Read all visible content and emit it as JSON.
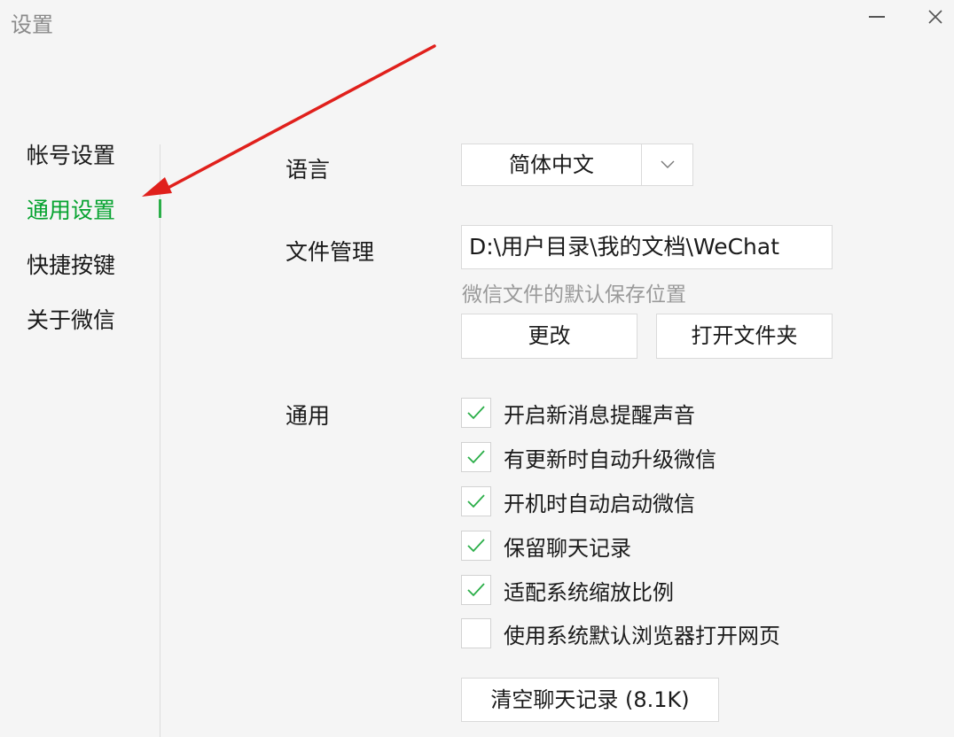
{
  "window": {
    "title": "设置"
  },
  "sidebar": {
    "items": [
      {
        "label": "帐号设置",
        "active": false
      },
      {
        "label": "通用设置",
        "active": true
      },
      {
        "label": "快捷按键",
        "active": false
      },
      {
        "label": "关于微信",
        "active": false
      }
    ]
  },
  "language": {
    "label": "语言",
    "value": "简体中文"
  },
  "file_management": {
    "label": "文件管理",
    "path": "D:\\用户目录\\我的文档\\WeChat",
    "hint": "微信文件的默认保存位置",
    "change_label": "更改",
    "open_folder_label": "打开文件夹"
  },
  "general": {
    "label": "通用",
    "options": [
      {
        "label": "开启新消息提醒声音",
        "checked": true
      },
      {
        "label": "有更新时自动升级微信",
        "checked": true
      },
      {
        "label": "开机时自动启动微信",
        "checked": true
      },
      {
        "label": "保留聊天记录",
        "checked": true
      },
      {
        "label": "适配系统缩放比例",
        "checked": true
      },
      {
        "label": "使用系统默认浏览器打开网页",
        "checked": false
      }
    ],
    "clear_history_label": "清空聊天记录 (8.1K)"
  },
  "colors": {
    "accent": "#07a330",
    "check": "#2aae48",
    "annotation_arrow": "#e0201c"
  }
}
